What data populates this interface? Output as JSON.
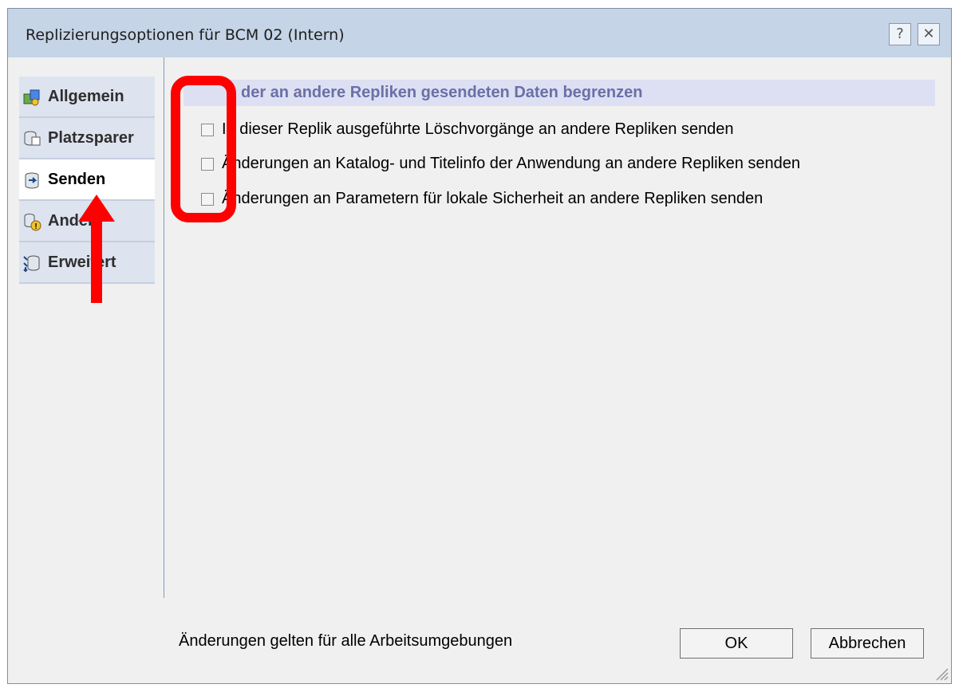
{
  "dialog": {
    "title": "Replizierungsoptionen für BCM 02 (Intern)",
    "help_label": "?",
    "close_label": "✕"
  },
  "sidebar": {
    "items": [
      {
        "label": "Allgemein",
        "icon": "general-settings-icon",
        "active": false
      },
      {
        "label": "Platzsparer",
        "icon": "database-space-icon",
        "active": false
      },
      {
        "label": "Senden",
        "icon": "send-database-icon",
        "active": true
      },
      {
        "label": "Andere",
        "icon": "database-warning-icon",
        "active": false
      },
      {
        "label": "Erweitert",
        "icon": "advanced-database-icon",
        "active": false
      }
    ]
  },
  "main": {
    "section_title": "der an andere Repliken gesendeten Daten begrenzen",
    "options": [
      {
        "label": "In dieser Replik ausgeführte Löschvorgänge an andere Repliken senden",
        "checked": false
      },
      {
        "label": "Änderungen an Katalog- und Titelinfo der Anwendung an andere Repliken senden",
        "checked": false
      },
      {
        "label": "Änderungen an Parametern für lokale Sicherheit an andere Repliken senden",
        "checked": false
      }
    ]
  },
  "footer": {
    "note": "Änderungen gelten für alle Arbeitsumgebungen",
    "ok_label": "OK",
    "cancel_label": "Abbrechen"
  },
  "colors": {
    "annotation": "#ff0000",
    "section_header_bg": "#dde0f2",
    "section_header_text": "#6b6fa8",
    "titlebar_bg": "#c5d4e6"
  }
}
